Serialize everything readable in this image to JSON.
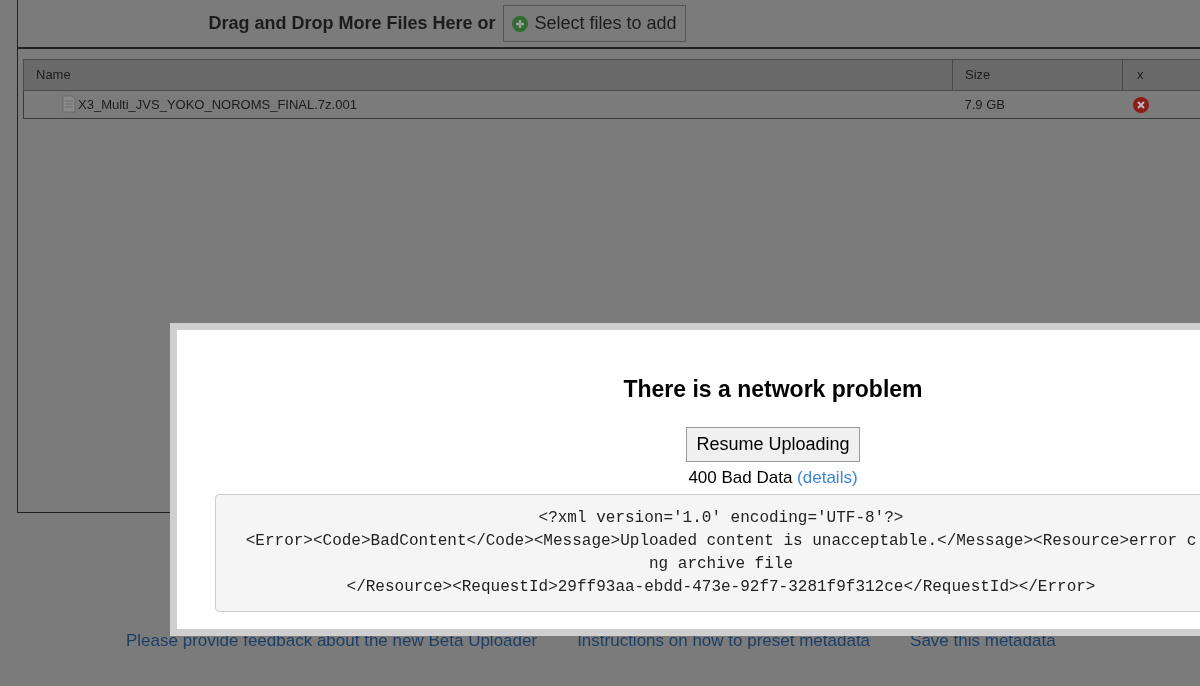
{
  "dropzone": {
    "text": "Drag and Drop More Files Here or",
    "button": "Select files to add"
  },
  "table": {
    "columns": [
      "Name",
      "Size",
      "x"
    ],
    "rows": [
      {
        "name": "X3_Multi_JVS_YOKO_NOROMS_FINAL.7z.001",
        "size": "7.9 GB"
      }
    ]
  },
  "footer_links": [
    "Please provide feedback about the new Beta Uploader",
    "Instructions on how to preset metadata",
    "Save this metadata"
  ],
  "dialog": {
    "title": "There is a network problem",
    "button": "Resume Uploading",
    "status": "400 Bad Data",
    "details_link": "(details)",
    "response_lines": [
      "<?xml version='1.0' encoding='UTF-8'?>",
      "<Error><Code>BadContent</Code><Message>Uploaded content is unacceptable.</Message><Resource>error c",
      "ng archive file",
      "</Resource><RequestId>29ff93aa-ebdd-473e-92f7-3281f9f312ce</RequestId></Error>"
    ]
  }
}
